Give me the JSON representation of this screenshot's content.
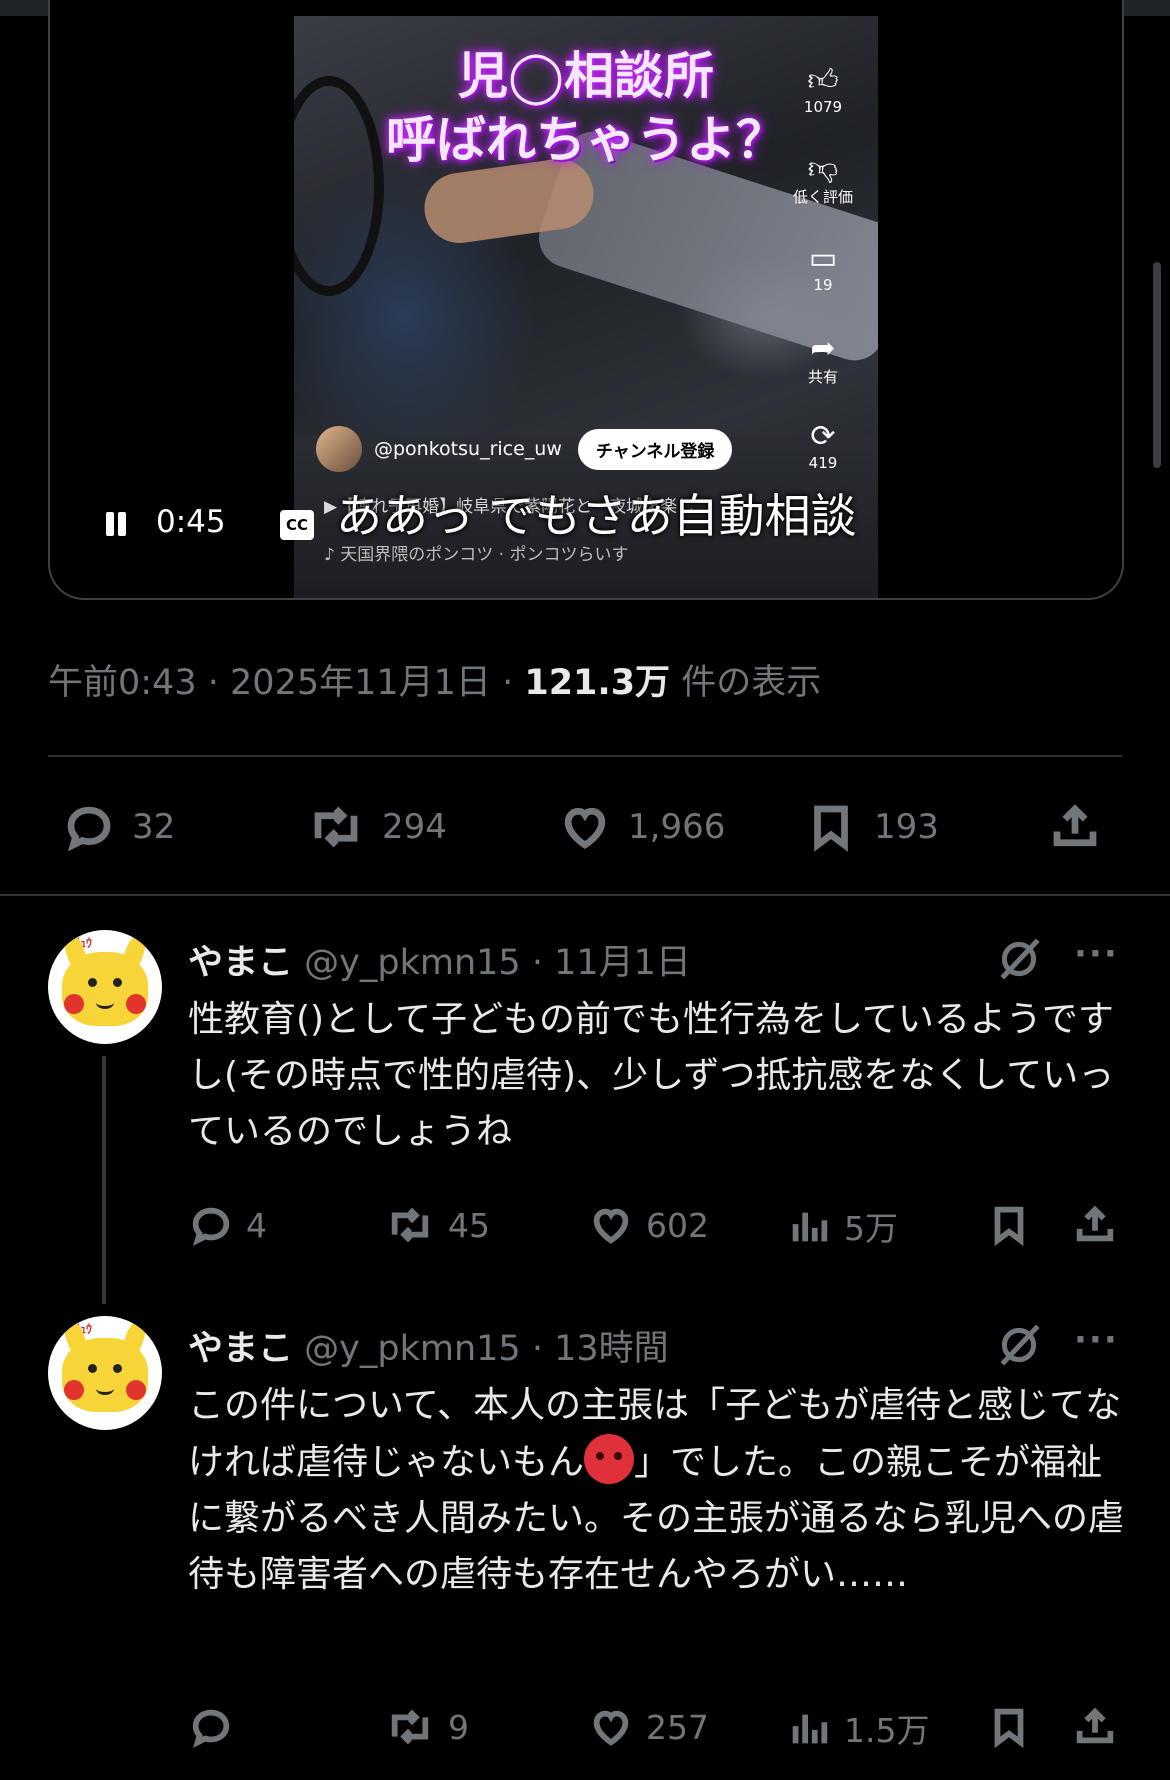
{
  "video": {
    "title_line1": "児◯相談所",
    "title_line2": "呼ばれちゃうよ？",
    "like_count": "1079",
    "dislike_label": "低く評価",
    "comment_count": "19",
    "share_label": "共有",
    "remix_count": "419",
    "channel_handle": "@ponkotsu_rice_uw",
    "subscribe_label": "チャンネル登録",
    "related_title": "▶【連れ子再婚】岐阜県で紫陽花と一夜城を楽し…",
    "music_line": "♪ 天国界隈のポンコツ · ポンコツらいす",
    "time": "0:45",
    "cc_label": "CC",
    "caption": "ああっ でもさあ自動相談"
  },
  "post_meta": {
    "time": "午前0:43",
    "sep": "·",
    "date": "2025年11月1日",
    "views": "121.3万",
    "views_label": "件の表示"
  },
  "post_actions": {
    "replies": "32",
    "reposts": "294",
    "likes": "1,966",
    "bookmarks": "193"
  },
  "replies": [
    {
      "name": "やまこ",
      "handle": "@y_pkmn15",
      "time": "· 11月1日",
      "text": "性教育()として子どもの前でも性行為をしているようですし(その時点で性的虐待)、少しずつ抵抗感をなくしていっているのでしょうね",
      "replies": "4",
      "reposts": "45",
      "likes": "602",
      "views": "5万",
      "avatar_tag": "ﾁｭｳ"
    },
    {
      "name": "やまこ",
      "handle": "@y_pkmn15",
      "time": "· 13時間",
      "text_part1": "この件について、本人の主張は「子どもが虐待と感じてなければ虐待じゃないもん",
      "text_part2": "」でした。この親こそが福祉に繋がるべき人間みたい。その主張が通るなら乳児への虐待も障害者への虐待も存在せんやろがい……",
      "replies": "",
      "reposts": "9",
      "likes": "257",
      "views": "1.5万",
      "avatar_tag": "ﾁｭｳ"
    }
  ],
  "more_label": "···",
  "colors": {
    "background": "#000000",
    "text": "#e7e9ea",
    "secondary": "#71767b",
    "border": "#2f3336"
  }
}
